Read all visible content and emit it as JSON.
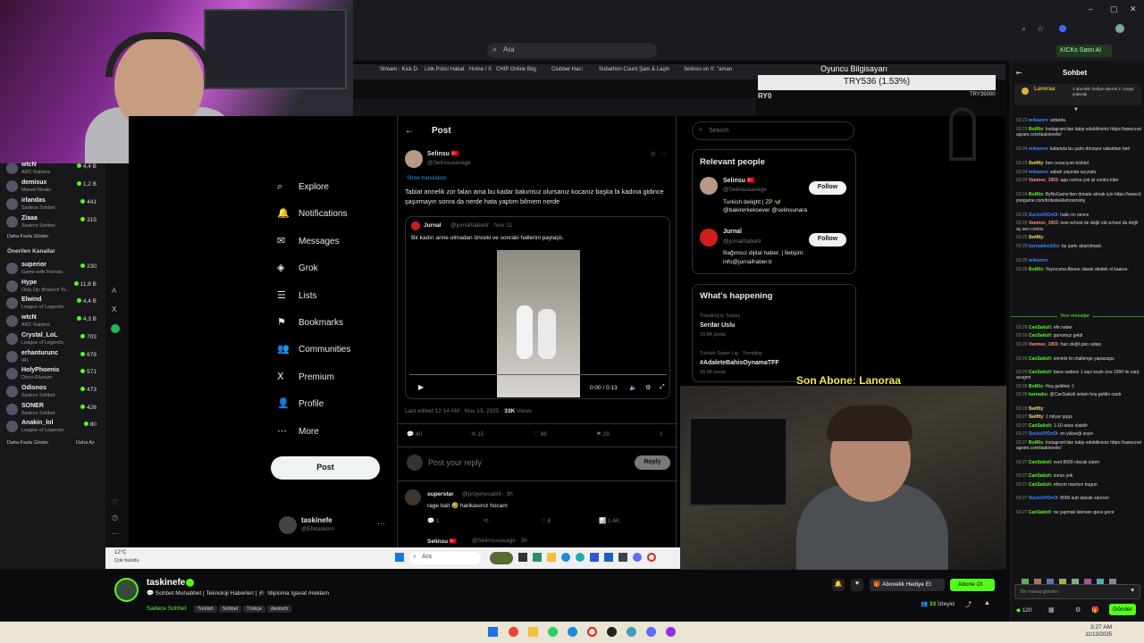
{
  "browser": {
    "address_text": "Ara",
    "kicks_button": "KICKs Satın Al"
  },
  "inner_tabs": [
    "Stream - Kick D.",
    "Link Polisi Hakat",
    "Home / X",
    "CHIP Online Bilg",
    "Clubber Hacı",
    "Subathon Count",
    "Şam & Laçin",
    "Selinsu on X: \"aman"
  ],
  "overlay": {
    "price": "TRY536 (1.53%)",
    "game_pc": "Oyuncu Bilgisayarı",
    "ry0": "RY0",
    "try35": "TRY35000",
    "son_abone": "Son Abone: Lanoraa"
  },
  "left_sidebar": {
    "channels_top": [
      {
        "name": "wtcN",
        "game": "ARC Raiders",
        "viewers": "4,4 B"
      },
      {
        "name": "demisux",
        "game": "Marvel Rivals",
        "viewers": "1,2 B"
      },
      {
        "name": "irlandas",
        "game": "Sadece Sohbet",
        "viewers": "441"
      },
      {
        "name": "Ziaaa",
        "game": "Sadece Sohbet",
        "viewers": "315"
      }
    ],
    "show_more": "Daha Fazla Göster",
    "recommended_title": "Önerilen Kanallar",
    "channels_rec": [
      {
        "name": "superior",
        "game": "Game with Friends",
        "viewers": "230"
      },
      {
        "name": "Hype",
        "game": "Only Up: Brainrot To...",
        "viewers": "11,8 B"
      },
      {
        "name": "Elwind",
        "game": "League of Legends",
        "viewers": "4,4 B"
      },
      {
        "name": "wtcN",
        "game": "ARC Raiders",
        "viewers": "4,3 B"
      },
      {
        "name": "Crystal_LoL",
        "game": "League of Legends",
        "viewers": "703"
      },
      {
        "name": "erhanturunc",
        "game": "IRL",
        "viewers": "678"
      },
      {
        "name": "HolyPhoenix",
        "game": "Disco Elysium",
        "viewers": "571"
      },
      {
        "name": "Odisnos",
        "game": "Sadece Sohbet",
        "viewers": "473"
      },
      {
        "name": "SONER",
        "game": "Sadece Sohbet",
        "viewers": "426"
      },
      {
        "name": "Anakin_lol",
        "game": "League of Legends",
        "viewers": "80"
      }
    ],
    "show_more2": "Daha Fazla Göster",
    "show_less": "Daha Az"
  },
  "x_nav": {
    "items": [
      {
        "icon": "⌕",
        "label": "Explore"
      },
      {
        "icon": "🔔",
        "label": "Notifications"
      },
      {
        "icon": "✉",
        "label": "Messages"
      },
      {
        "icon": "◈",
        "label": "Grok"
      },
      {
        "icon": "☰",
        "label": "Lists"
      },
      {
        "icon": "⚑",
        "label": "Bookmarks"
      },
      {
        "icon": "👥",
        "label": "Communities"
      },
      {
        "icon": "X",
        "label": "Premium"
      },
      {
        "icon": "👤",
        "label": "Profile"
      },
      {
        "icon": "⋯",
        "label": "More"
      }
    ],
    "post_button": "Post",
    "me_name": "taskinefe",
    "me_handle": "@Efetaskinn"
  },
  "feed": {
    "header": "Post",
    "author": "Selinsu 🇹🇷",
    "author_handle": "@Selinsusavage",
    "show_translation": "Show translation",
    "text": "Tabiat annelik zor falan ama bu kadar bakımsız olursanız kocanız başka bi kadına gidince şaşırmayın sonra da nerde hata yaptım bilmem nerde",
    "quote_author": "Jurnal",
    "quote_handle": "@jurnalhabertr · Nov 11",
    "quote_text": "Bir kadın anne olmadan önceki ve sonraki hallerini paylaştı.",
    "video_time": "0:00 / 0:13",
    "edited": "Last edited 12:14 AM · Nov 13, 2025 ·",
    "views": "33K",
    "views_label": "Views",
    "stats": {
      "replies": "40",
      "reposts": "15",
      "likes": "86",
      "bookmarks": "29"
    },
    "reply_placeholder": "Post your reply",
    "reply_button": "Reply",
    "reply1_author": "superstar",
    "reply1_handle": "@projehesabi9 · 3h",
    "reply1_text": "rage bait 🤣 harikasınız hocam",
    "reply1_stats": {
      "replies": "1",
      "likes": "8",
      "views": "1,6K"
    },
    "reply2_author": "Selinsu 🇹🇷",
    "reply2_handle": "@Selinsusavage · 3h"
  },
  "x_right": {
    "search_placeholder": "Search",
    "relevant_title": "Relevant people",
    "people": [
      {
        "name": "Selinsu 🇹🇷",
        "handle": "@Selinsusavage",
        "bio": "Turkish delight | ZP 🦋",
        "bio2": "@bakirerkeksever @selinsunara",
        "follow": "Follow"
      },
      {
        "name": "Jurnal",
        "handle": "@jurnalhabertr",
        "bio": "Bağımsız dijital haber. | İletişim:",
        "bio2": "info@jurnalhaber.tr",
        "follow": "Follow"
      }
    ],
    "happening_title": "What's happening",
    "trends": [
      {
        "ctx": "Trending in Turkey",
        "name": "Serdar Uslu",
        "count": "19,8K posts"
      },
      {
        "ctx": "Turkish Super Lig · Trending",
        "name": "#AdaleteBahisOynamaTFF",
        "count": "20,6K posts"
      }
    ]
  },
  "inner_taskbar": {
    "weather": "12°C",
    "weather_sub": "Çok bulutlu",
    "search": "Ara"
  },
  "stream_info": {
    "name": "taskinefe",
    "title": "💬 Sohbet Muhabbet | Teknoloji Haberleri | 🎓 !diploma !gavat #reklam",
    "category": "Sadece Sohbet",
    "tags": [
      "Turkish",
      "Sohbet",
      "Türkçe",
      "deutsch"
    ],
    "gift_button": "Abonelik Hediye Et",
    "sub_button": "Abone Ol",
    "viewers": "33",
    "viewers_label": "İzleyici"
  },
  "chat": {
    "title": "Sohbet",
    "gift_banner_user": "Lanoraa",
    "gift_banner_text": "1 abonelik hediye ederek 2. sıraya yükseldi",
    "new_messages": "Yeni mesajlar",
    "messages": [
      {
        "t": "03:22",
        "u": "m4xanrrı",
        "c": "#3c8cff",
        "m": "ardarda"
      },
      {
        "t": "03:23",
        "u": "BotRix",
        "c": "#53fc18",
        "m": "İnstagram'dan takip edebilirsiniz https://www.instagram.com/taskinnefe/"
      },
      {
        "t": "03:24",
        "u": "m4xanrrı",
        "c": "#3c8cff",
        "m": "kafamda bu şarkı dönüyor sabahtan beri"
      },
      {
        "t": "03:24",
        "u": "Swiftly",
        "c": "#f4e35a",
        "m": "ben cezacıyım kıldıkd"
      },
      {
        "t": "03:24",
        "u": "m4xanrrı",
        "c": "#3c8cff",
        "m": "sabah yayında açıyodu"
      },
      {
        "t": "03:24",
        "u": "Vanmes_1903",
        "c": "#ff8a8a",
        "m": "aga contra çok iyi contra kibir"
      },
      {
        "t": "03:24",
        "u": "BotRix",
        "c": "#53fc18",
        "m": "ByNoGame'den donate atmak için https://www.bynogame.com/tr/destekle/nosminty"
      },
      {
        "t": "03:25",
        "u": "SucksOfOnOl",
        "c": "#3c8cff",
        "m": "haklı mı sence"
      },
      {
        "t": "03:25",
        "u": "Vanmes_1903",
        "c": "#ff8a8a",
        "m": "new school de değil old school da değil aç sen contra"
      },
      {
        "t": "03:25",
        "u": "Swiftly",
        "c": "#f4e35a",
        "m": ""
      },
      {
        "t": "03:25",
        "u": "barryallen10rc",
        "c": "#3c8cff",
        "m": "bu şarkı abartılmadı"
      },
      {
        "t": "03:25",
        "u": "m4xanrrı",
        "c": "#3c8cff",
        "m": ""
      },
      {
        "t": "03:26",
        "u": "BotRix",
        "c": "#53fc18",
        "m": "Yayıncıma Abone olarak destek ol kaanın."
      }
    ],
    "messages2": [
      {
        "t": "03:26",
        "u": "CanSakizli",
        "c": "#53fc18",
        "m": "efe naber"
      },
      {
        "t": "03:26",
        "u": "CanSakizli",
        "c": "#53fc18",
        "m": "gunumuz geldi"
      },
      {
        "t": "03:26",
        "u": "Vanmes_1903",
        "c": "#ff8a8a",
        "m": "hacı değil gacı adayı"
      },
      {
        "t": "03:26",
        "u": "CanSakizli",
        "c": "#53fc18",
        "m": "seninle bi challenge yapacagız"
      },
      {
        "t": "03:26",
        "u": "CanSakizli",
        "c": "#53fc18",
        "m": "bana sadece 1 sayi soyle onu 1000 ile carpacagım"
      },
      {
        "t": "03:26",
        "u": "BotRix",
        "c": "#53fc18",
        "m": "Hoş geldiniz :)"
      },
      {
        "t": "03:26",
        "u": "harmaliu",
        "c": "#53fc18",
        "m": "@CanSakizli selam hoş geldin canb"
      },
      {
        "t": "03:26",
        "u": "Swiftly",
        "c": "#f4e35a",
        "m": ""
      },
      {
        "t": "03:27",
        "u": "Swiftly",
        "c": "#f4e35a",
        "m": "1 milyar şişşs"
      },
      {
        "t": "03:27",
        "u": "CanSakizli",
        "c": "#53fc18",
        "m": "1-10 arası olabilir"
      },
      {
        "t": "03:27",
        "u": "SucksOfOnOl",
        "c": "#3c8cff",
        "m": "en yükseği soyle"
      },
      {
        "t": "03:27",
        "u": "BotRix",
        "c": "#53fc18",
        "m": "İnstagram'dan takip edebilirsiniz https://www.instagram.com/taskinnefe/"
      },
      {
        "t": "03:27",
        "u": "CanSakizli",
        "c": "#53fc18",
        "m": "evet 8000 olacak zaten"
      },
      {
        "t": "03:27",
        "u": "CanSakizli",
        "c": "#53fc18",
        "m": "sorun yok"
      },
      {
        "t": "03:27",
        "u": "CanSakizli",
        "c": "#53fc18",
        "m": "efecım nasılsın bugun"
      },
      {
        "t": "03:27",
        "u": "SucksOfOnOl",
        "c": "#3c8cff",
        "m": "8000 sub alacak sanırım"
      },
      {
        "t": "03:27",
        "u": "CanSakizli",
        "c": "#53fc18",
        "m": "ne yapmak istersen gece gece"
      }
    ],
    "input_placeholder": "Bir mesaj gönder",
    "kicks_count": "120",
    "send_button": "Gönder"
  },
  "taskbar": {
    "time": "3:27 AM",
    "date": "11/13/2025"
  }
}
